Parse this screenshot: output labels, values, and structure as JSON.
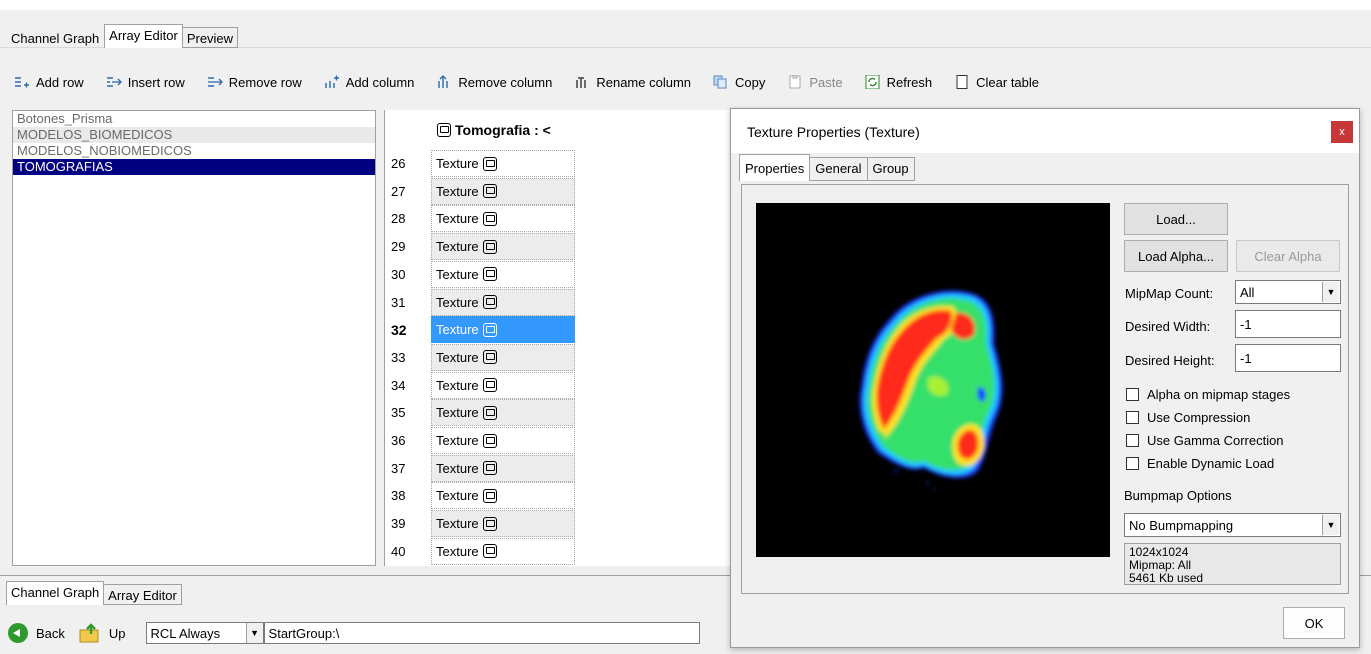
{
  "top_tabs": [
    "Channel Graph",
    "Array Editor",
    "Preview"
  ],
  "toolbar": {
    "add_row": "Add row",
    "insert_row": "Insert row",
    "remove_row": "Remove row",
    "add_column": "Add column",
    "remove_column": "Remove column",
    "rename_column": "Rename column",
    "copy": "Copy",
    "paste": "Paste",
    "refresh": "Refresh",
    "clear_table": "Clear table"
  },
  "groups": [
    "Botones_Prisma",
    "MODELOS_BIOMEDICOS",
    "MODELOS_NOBIOMEDICOS",
    "TOMOGRAFIAS"
  ],
  "grid": {
    "column_header": "Tomografia : <",
    "rows": [
      {
        "num": "26",
        "value": "Texture"
      },
      {
        "num": "27",
        "value": "Texture"
      },
      {
        "num": "28",
        "value": "Texture"
      },
      {
        "num": "29",
        "value": "Texture"
      },
      {
        "num": "30",
        "value": "Texture"
      },
      {
        "num": "31",
        "value": "Texture"
      },
      {
        "num": "32",
        "value": "Texture"
      },
      {
        "num": "33",
        "value": "Texture"
      },
      {
        "num": "34",
        "value": "Texture"
      },
      {
        "num": "35",
        "value": "Texture"
      },
      {
        "num": "36",
        "value": "Texture"
      },
      {
        "num": "37",
        "value": "Texture"
      },
      {
        "num": "38",
        "value": "Texture"
      },
      {
        "num": "39",
        "value": "Texture"
      },
      {
        "num": "40",
        "value": "Texture"
      }
    ]
  },
  "bottom_tabs": [
    "Channel Graph",
    "Array Editor"
  ],
  "statusbar": {
    "back": "Back",
    "up": "Up",
    "mode": "RCL Always",
    "path": "StartGroup:\\"
  },
  "dialog": {
    "title": "Texture Properties (Texture)",
    "close": "x",
    "tabs": [
      "Properties",
      "General",
      "Group"
    ],
    "load": "Load...",
    "load_alpha": "Load Alpha...",
    "clear_alpha": "Clear Alpha",
    "mipmap_label": "MipMap Count:",
    "mipmap_value": "All",
    "width_label": "Desired Width:",
    "width_value": "-1",
    "height_label": "Desired Height:",
    "height_value": "-1",
    "checks": [
      "Alpha on mipmap stages",
      "Use Compression",
      "Use Gamma Correction",
      "Enable Dynamic Load"
    ],
    "bump_label": "Bumpmap Options",
    "bump_value": "No Bumpmapping",
    "info_lines": [
      "1024x1024",
      "Mipmap: All",
      "5461 Kb used"
    ],
    "ok": "OK"
  }
}
